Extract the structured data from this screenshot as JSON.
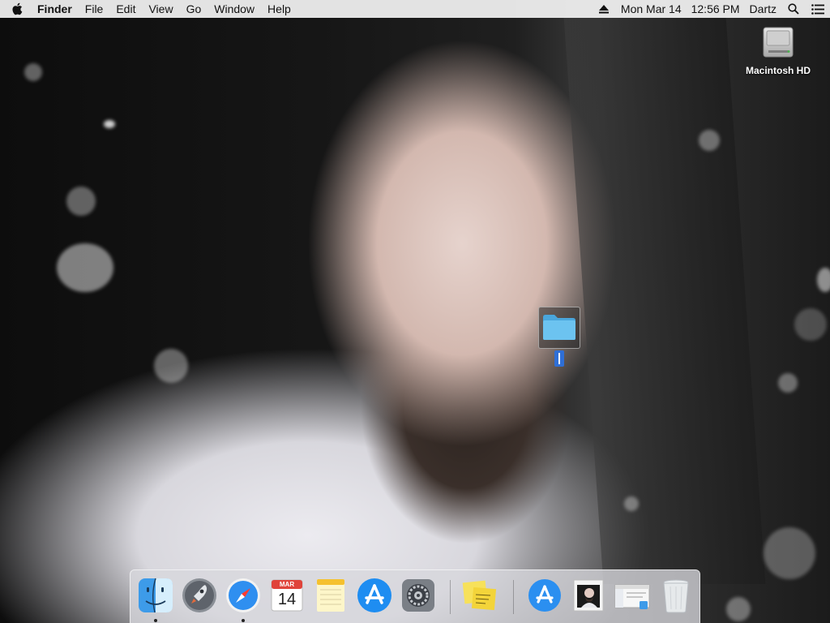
{
  "menubar": {
    "apple_icon": "apple-icon",
    "app_name": "Finder",
    "menus": [
      "File",
      "Edit",
      "View",
      "Go",
      "Window",
      "Help"
    ],
    "date": "Mon Mar 14",
    "time": "12:56 PM",
    "user": "Dartz",
    "status_icons": [
      "eject-icon",
      "search-icon",
      "notification-center-icon"
    ]
  },
  "desktop": {
    "drive_label": "Macintosh HD",
    "dragged_item": "folder-icon"
  },
  "dock": {
    "apps": [
      {
        "name": "Finder",
        "icon": "finder-icon",
        "running": true
      },
      {
        "name": "Launchpad",
        "icon": "launchpad-icon",
        "running": false
      },
      {
        "name": "Safari",
        "icon": "safari-icon",
        "running": true
      },
      {
        "name": "Calendar",
        "icon": "calendar-icon",
        "running": false,
        "month": "MAR",
        "day": "14"
      },
      {
        "name": "Notes",
        "icon": "notes-icon",
        "running": false
      },
      {
        "name": "App Store",
        "icon": "app-store-icon",
        "running": false
      },
      {
        "name": "System Preferences",
        "icon": "system-preferences-icon",
        "running": false
      },
      {
        "name": "Stickies",
        "icon": "stickies-icon",
        "running": false
      }
    ],
    "stacks": [
      {
        "name": "Applications",
        "icon": "app-store-folder-icon"
      },
      {
        "name": "Image",
        "icon": "photo-thumbnail-icon"
      },
      {
        "name": "Finder Window",
        "icon": "window-preview-icon"
      },
      {
        "name": "Trash",
        "icon": "trash-icon"
      }
    ]
  },
  "colors": {
    "menubar_bg": "#f0f0f0",
    "folder_blue": "#5db6ea",
    "selection_blue": "#2f6fd6"
  }
}
